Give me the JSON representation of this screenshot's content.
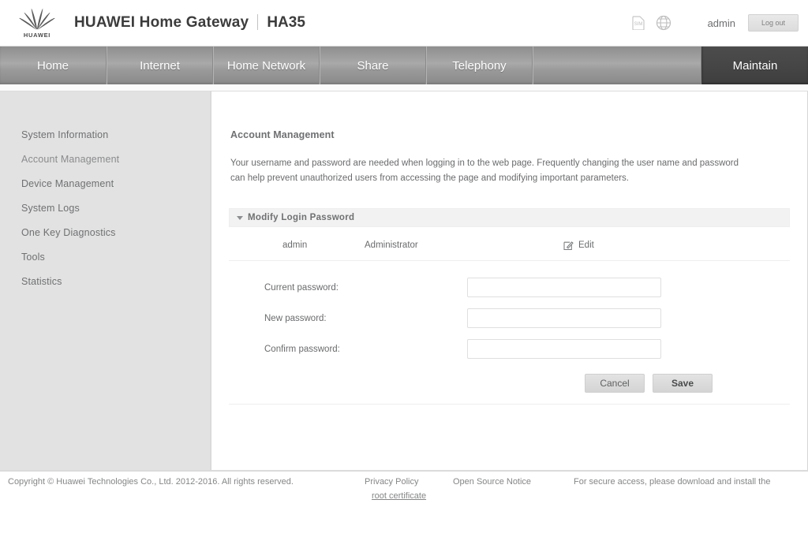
{
  "header": {
    "logo_alt": "HUAWEI",
    "logo_wordmark": "HUAWEI",
    "brand_title": "HUAWEI Home Gateway",
    "model": "HA35",
    "sim_icon_label": "SIM",
    "globe_icon_label": "language",
    "user": "admin",
    "logout_label": "Log out"
  },
  "nav": {
    "items": [
      {
        "label": "Home",
        "active": false
      },
      {
        "label": "Internet",
        "active": false
      },
      {
        "label": "Home Network",
        "active": false
      },
      {
        "label": "Share",
        "active": false
      },
      {
        "label": "Telephony",
        "active": false
      },
      {
        "label": "Maintain",
        "active": true
      }
    ]
  },
  "sidebar": {
    "items": [
      {
        "label": "System Information",
        "selected": false
      },
      {
        "label": "Account Management",
        "selected": true
      },
      {
        "label": "Device Management",
        "selected": false
      },
      {
        "label": "System Logs",
        "selected": false
      },
      {
        "label": "One Key Diagnostics",
        "selected": false
      },
      {
        "label": "Tools",
        "selected": false
      },
      {
        "label": "Statistics",
        "selected": false
      }
    ]
  },
  "main": {
    "title": "Account Management",
    "description": "Your username and password are needed when logging in to the web page. Frequently changing the user name and password can help prevent unauthorized users from accessing the page and modifying important parameters.",
    "panel": {
      "header_label": "Modify Login Password",
      "expanded": true,
      "account_row": {
        "username": "admin",
        "role": "Administrator",
        "edit_label": "Edit"
      },
      "fields": [
        {
          "label": "Current password:",
          "value": "",
          "placeholder": ""
        },
        {
          "label": "New password:",
          "value": "",
          "placeholder": ""
        },
        {
          "label": "Confirm password:",
          "value": "",
          "placeholder": ""
        }
      ],
      "buttons": {
        "cancel": "Cancel",
        "save": "Save"
      }
    }
  },
  "footer": {
    "copyright": "Copyright © Huawei Technologies Co., Ltd. 2012-2016. All rights reserved.",
    "privacy_policy": "Privacy Policy",
    "open_source_notice": "Open Source Notice",
    "secure_access_text": "For secure access, please download and install the",
    "root_certificate_link": "root certificate"
  },
  "colors": {
    "nav_active": "#464646",
    "sidebar_bg": "#e2e2e2",
    "panel_head_bg": "#f2f2f2",
    "text": "#6a6b6d"
  }
}
